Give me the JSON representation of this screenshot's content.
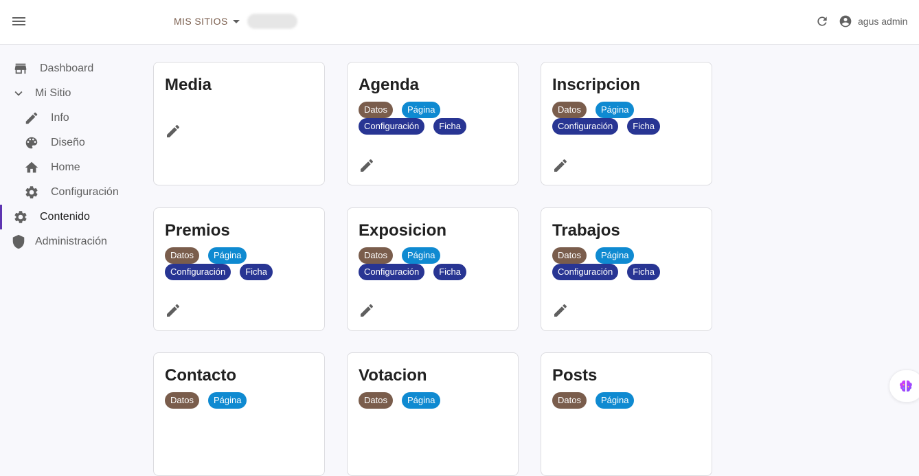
{
  "topbar": {
    "sites_label": "MIS SITIOS",
    "user_name": "agus admin"
  },
  "sidebar": {
    "items": [
      {
        "label": "Dashboard",
        "icon": "store-icon"
      },
      {
        "label": "Mi Sitio",
        "icon": "chevron-down-icon"
      },
      {
        "label": "Info",
        "icon": "pencil-icon"
      },
      {
        "label": "Diseño",
        "icon": "palette-icon"
      },
      {
        "label": "Home",
        "icon": "home-icon"
      },
      {
        "label": "Configuración",
        "icon": "gear-icon"
      },
      {
        "label": "Contenido",
        "icon": "gear-icon"
      },
      {
        "label": "Administración",
        "icon": "shield-icon"
      }
    ]
  },
  "tags": {
    "datos": "Datos",
    "pagina": "Página",
    "config": "Configuración",
    "ficha": "Ficha"
  },
  "cards": [
    {
      "title": "Media"
    },
    {
      "title": "Agenda"
    },
    {
      "title": "Inscripcion"
    },
    {
      "title": "Premios"
    },
    {
      "title": "Exposicion"
    },
    {
      "title": "Trabajos"
    },
    {
      "title": "Contacto"
    },
    {
      "title": "Votacion"
    },
    {
      "title": "Posts"
    }
  ],
  "colors": {
    "accent": "#5e35b1",
    "datos": "#7a5d4c",
    "pagina": "#0f8ad1",
    "config": "#283593"
  }
}
